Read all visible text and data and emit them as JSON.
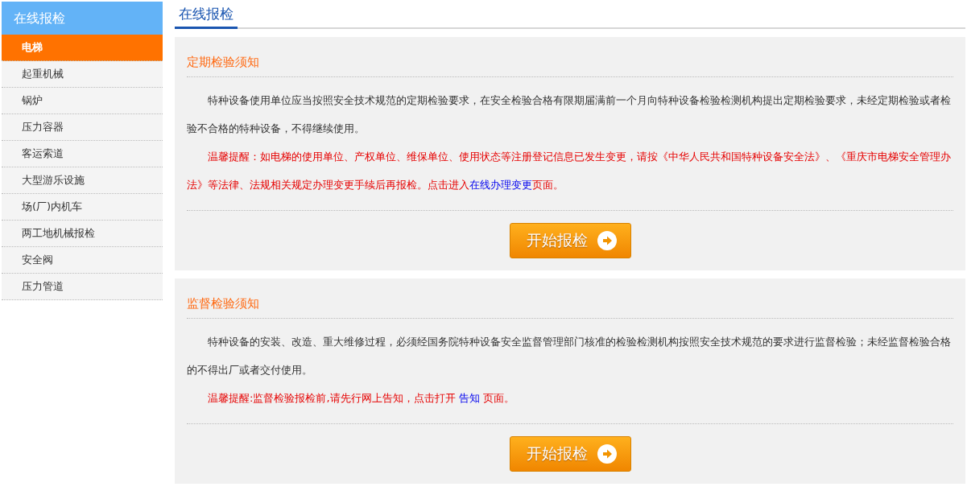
{
  "sidebar": {
    "title": "在线报检",
    "items": [
      {
        "label": "电梯",
        "selected": true
      },
      {
        "label": "起重机械",
        "selected": false
      },
      {
        "label": "锅炉",
        "selected": false
      },
      {
        "label": "压力容器",
        "selected": false
      },
      {
        "label": "客运索道",
        "selected": false
      },
      {
        "label": "大型游乐设施",
        "selected": false
      },
      {
        "label": "场(厂)内机车",
        "selected": false
      },
      {
        "label": "两工地机械报检",
        "selected": false
      },
      {
        "label": "安全阀",
        "selected": false
      },
      {
        "label": "压力管道",
        "selected": false
      }
    ]
  },
  "page_tab": "在线报检",
  "sections": [
    {
      "title": "定期检验须知",
      "body": "特种设备使用单位应当按照安全技术规范的定期检验要求，在安全检验合格有限期届满前一个月向特种设备检验检测机构提出定期检验要求，未经定期检验或者检验不合格的特种设备，不得继续使用。",
      "tip": {
        "before": "温馨提醒：如电梯的使用单位、产权单位、维保单位、使用状态等注册登记信息已发生变更，请按《中华人民共和国特种设备安全法》、《重庆市电梯安全管理办法》等法律、法规相关规定办理变更手续后再报检。点击进入",
        "link": "在线办理变更",
        "after": "页面。"
      },
      "button": "开始报检"
    },
    {
      "title": "监督检验须知",
      "body": "特种设备的安装、改造、重大维修过程，必须经国务院特种设备安全监督管理部门核准的检验检测机构按照安全技术规范的要求进行监督检验；未经监督检验合格的不得出厂或者交付使用。",
      "tip": {
        "before": "温馨提醒:监督检验报检前,请先行网上告知，点击打开 ",
        "link": "告知",
        "after": " 页面。"
      },
      "button": "开始报检"
    }
  ]
}
